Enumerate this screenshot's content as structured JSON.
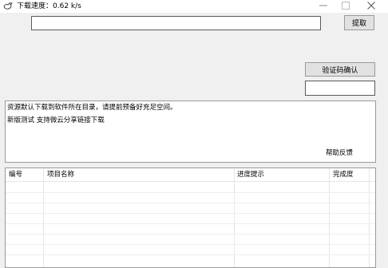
{
  "window": {
    "title": "下载速度：0.62 k/s",
    "icon": "bird-icon",
    "controls": [
      "minimize-icon",
      "maximize-icon",
      "close-icon"
    ]
  },
  "url_input": {
    "value": ""
  },
  "extract_button": {
    "label": "提取"
  },
  "verify_button": {
    "label": "验证码确认"
  },
  "code_input": {
    "value": ""
  },
  "messages": {
    "line1": "资源默认下载到软件所在目录，请提前预备好充足空间。",
    "line2": "新版测试 支持微云分享链接下载",
    "help_link": "帮助反馈"
  },
  "list": {
    "columns": [
      "编号",
      "项目名称",
      "进度提示",
      "完成度"
    ],
    "rows": []
  }
}
